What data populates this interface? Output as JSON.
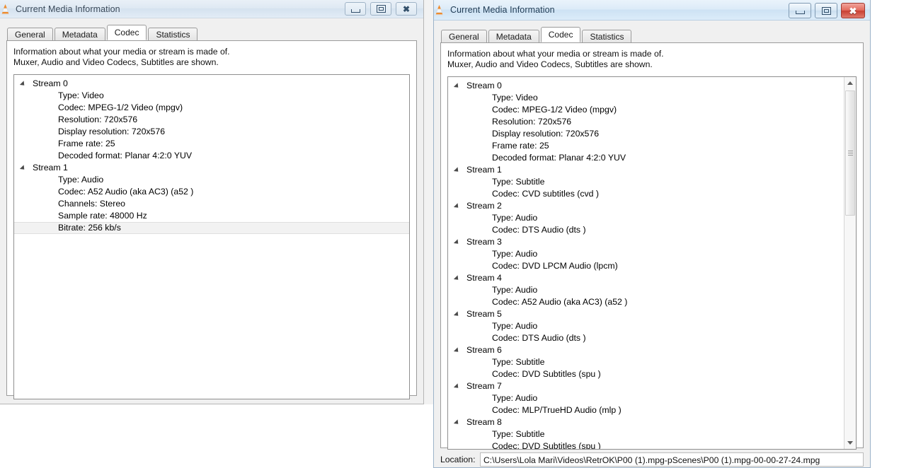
{
  "app": {
    "icon": "vlc-cone-icon",
    "title": "Current Media Information"
  },
  "tabs": {
    "items": [
      {
        "id": "general",
        "label": "General"
      },
      {
        "id": "metadata",
        "label": "Metadata"
      },
      {
        "id": "codec",
        "label": "Codec"
      },
      {
        "id": "statistics",
        "label": "Statistics"
      }
    ],
    "active": "codec"
  },
  "codec_panel": {
    "description_line1": "Information about what your media or stream is made of.",
    "description_line2": "Muxer, Audio and Video Codecs, Subtitles are shown."
  },
  "window_buttons": {
    "minimize": "minimize-button",
    "maximize": "maximize-button",
    "close": "close-button",
    "close_color": "#c83f32"
  },
  "left_window": {
    "state": "inactive",
    "streams": [
      {
        "label": "Stream 0",
        "rows": [
          "Type: Video",
          "Codec: MPEG-1/2 Video (mpgv)",
          "Resolution: 720x576",
          "Display resolution: 720x576",
          "Frame rate: 25",
          "Decoded format: Planar 4:2:0 YUV"
        ]
      },
      {
        "label": "Stream 1",
        "rows": [
          "Type: Audio",
          "Codec: A52 Audio (aka AC3) (a52 )",
          "Channels: Stereo",
          "Sample rate: 48000 Hz",
          "Bitrate: 256 kb/s"
        ],
        "selected_row_index": 4
      }
    ]
  },
  "right_window": {
    "state": "active",
    "streams": [
      {
        "label": "Stream 0",
        "rows": [
          "Type: Video",
          "Codec: MPEG-1/2 Video (mpgv)",
          "Resolution: 720x576",
          "Display resolution: 720x576",
          "Frame rate: 25",
          "Decoded format: Planar 4:2:0 YUV"
        ]
      },
      {
        "label": "Stream 1",
        "rows": [
          "Type: Subtitle",
          "Codec: CVD subtitles (cvd )"
        ]
      },
      {
        "label": "Stream 2",
        "rows": [
          "Type: Audio",
          "Codec: DTS Audio (dts )"
        ]
      },
      {
        "label": "Stream 3",
        "rows": [
          "Type: Audio",
          "Codec: DVD LPCM Audio (lpcm)"
        ]
      },
      {
        "label": "Stream 4",
        "rows": [
          "Type: Audio",
          "Codec: A52 Audio (aka AC3) (a52 )"
        ]
      },
      {
        "label": "Stream 5",
        "rows": [
          "Type: Audio",
          "Codec: DTS Audio (dts )"
        ]
      },
      {
        "label": "Stream 6",
        "rows": [
          "Type: Subtitle",
          "Codec: DVD Subtitles (spu )"
        ]
      },
      {
        "label": "Stream 7",
        "rows": [
          "Type: Audio",
          "Codec: MLP/TrueHD Audio (mlp )"
        ]
      },
      {
        "label": "Stream 8",
        "rows": [
          "Type: Subtitle",
          "Codec: DVD Subtitles (spu )"
        ]
      }
    ],
    "scrollbar": {
      "up_arrow": "scroll-up-icon",
      "down_arrow": "scroll-down-icon",
      "thumb": "scroll-thumb"
    },
    "location": {
      "label": "Location:",
      "value": "C:\\Users\\Lola Mari\\Videos\\RetrOK\\P00 (1).mpg-pScenes\\P00 (1).mpg-00-00-27-24.mpg"
    }
  }
}
